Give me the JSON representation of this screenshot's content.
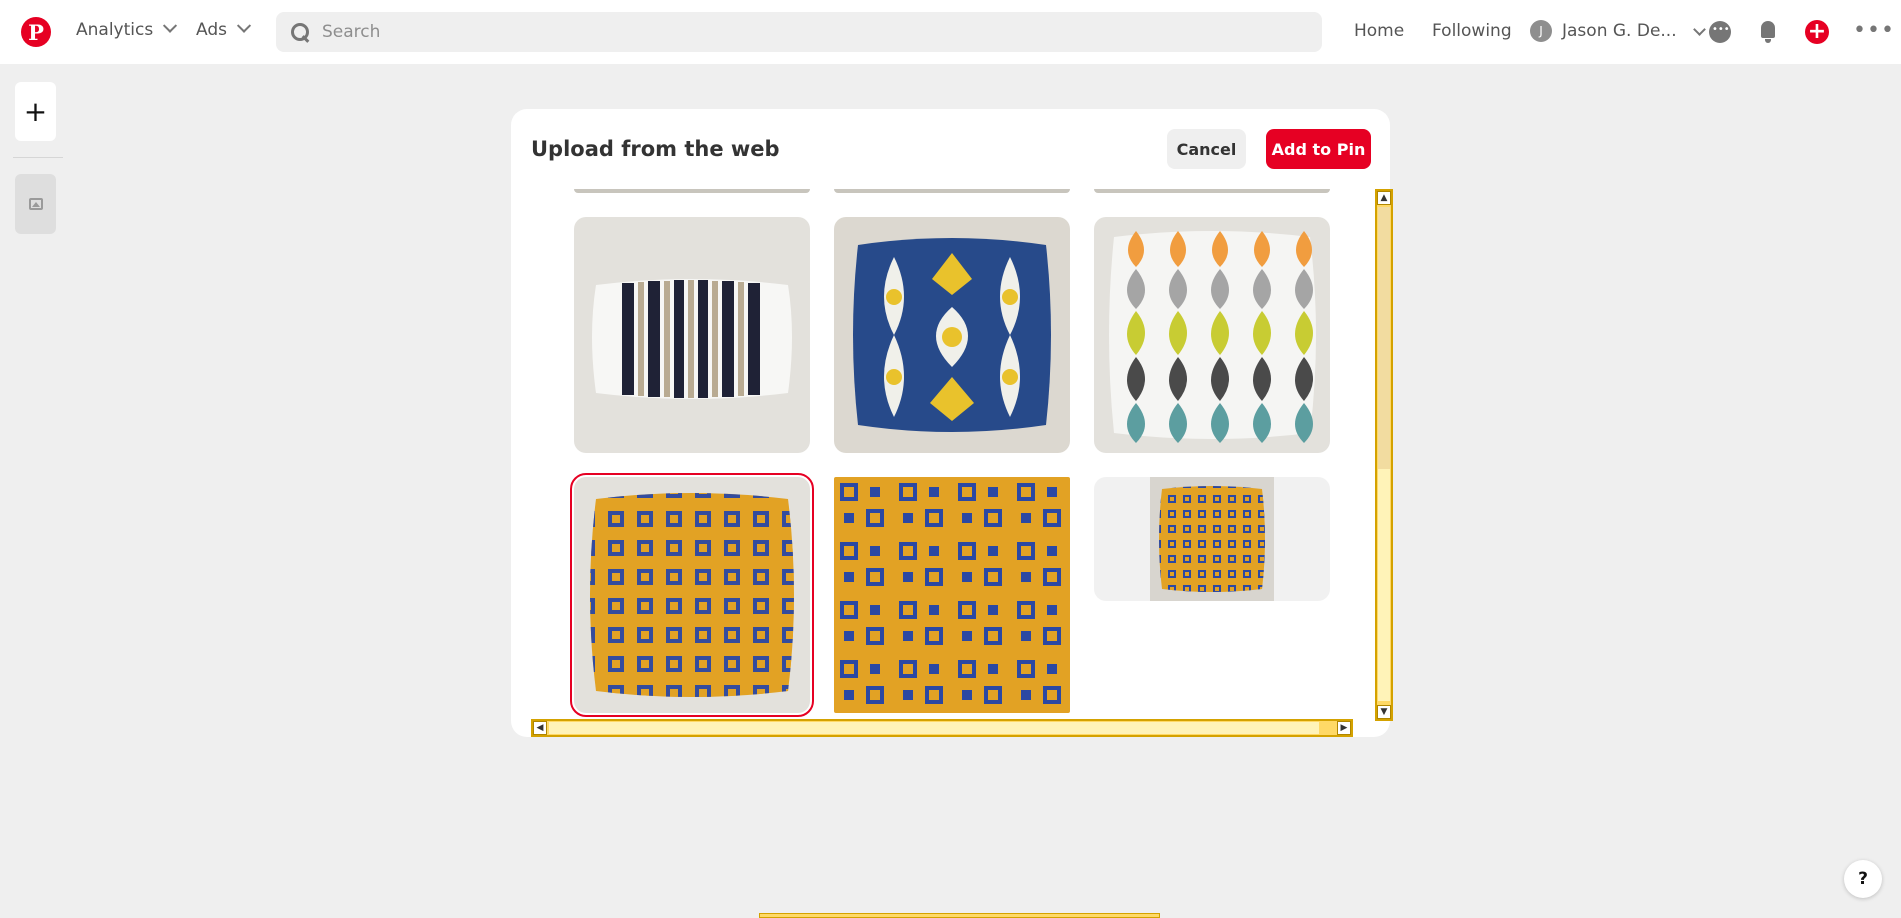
{
  "topbar": {
    "analytics_label": "Analytics",
    "ads_label": "Ads",
    "search_placeholder": "Search",
    "home_label": "Home",
    "following_label": "Following",
    "user_initial": "J",
    "user_name": "Jason G. De..."
  },
  "rail": {
    "add_icon": "+"
  },
  "modal": {
    "title": "Upload from the web",
    "cancel_label": "Cancel",
    "add_label": "Add to Pin"
  },
  "images": [
    {
      "name": "striped-lumbar-pillow",
      "selected": false
    },
    {
      "name": "blue-yellow-ikat-pillow",
      "selected": false
    },
    {
      "name": "teardrop-pattern-pillow",
      "selected": false
    },
    {
      "name": "yellow-blue-squares-pillow",
      "selected": true
    },
    {
      "name": "yellow-blue-squares-pattern",
      "selected": false
    },
    {
      "name": "yellow-blue-squares-pillow-small",
      "selected": false
    }
  ],
  "help": {
    "label": "?"
  },
  "colors": {
    "brand_red": "#e60023",
    "pattern_yellow": "#e2a224",
    "pattern_blue": "#2b48a3"
  }
}
